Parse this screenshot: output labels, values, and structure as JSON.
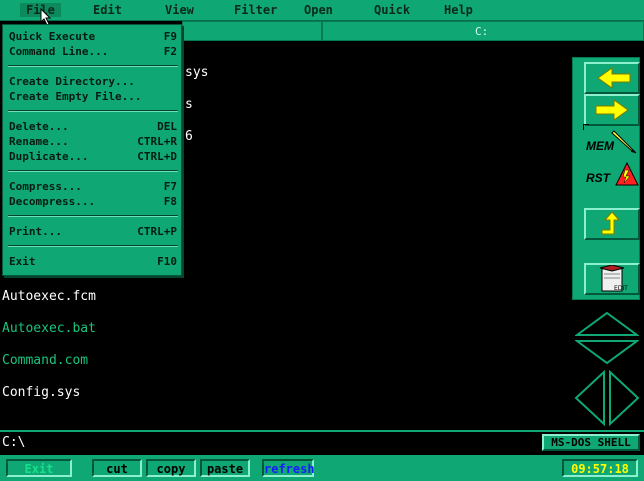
{
  "menubar": {
    "items": [
      {
        "label": "File",
        "active": true
      },
      {
        "label": "Edit"
      },
      {
        "label": "View"
      },
      {
        "label": "Filter"
      },
      {
        "label": "Open"
      },
      {
        "label": "Quick"
      },
      {
        "label": "Help"
      }
    ]
  },
  "panel": {
    "drive_label": "C:"
  },
  "file_menu": {
    "items": [
      {
        "label": "Quick Execute",
        "key": "F9"
      },
      {
        "label": "Command Line...",
        "key": "F2"
      },
      {
        "label": "Create Directory...",
        "key": ""
      },
      {
        "label": "Create Empty File...",
        "key": ""
      },
      {
        "label": "Delete...",
        "key": "DEL"
      },
      {
        "label": "Rename...",
        "key": "CTRL+R"
      },
      {
        "label": "Duplicate...",
        "key": "CTRL+D"
      },
      {
        "label": "Compress...",
        "key": "F7"
      },
      {
        "label": "Decompress...",
        "key": "F8"
      },
      {
        "label": "Print...",
        "key": "CTRL+P"
      },
      {
        "label": "Exit",
        "key": "F10"
      }
    ]
  },
  "files": {
    "hidden_partial": [
      "sys",
      "s",
      "6"
    ],
    "visible": [
      {
        "name": "Autoexec.fcm",
        "color": "white"
      },
      {
        "name": "Autoexec.bat",
        "color": "green"
      },
      {
        "name": "Command.com",
        "color": "green"
      },
      {
        "name": "Config.sys",
        "color": "white"
      }
    ]
  },
  "side_panel": {
    "mem_label": "MEM",
    "rst_label": "RST",
    "edit_label": "EDIT"
  },
  "command_line": {
    "prompt": "C:\\"
  },
  "shell_badge": "MS-DOS SHELL",
  "bottom": {
    "exit_label": "Exit",
    "cut_label": "cut",
    "copy_label": "copy",
    "paste_label": "paste",
    "refresh_label": "refresh",
    "clock": "09:57:18"
  },
  "colors": {
    "accent": "#0fa874",
    "accent_dark": "#03583a",
    "highlight": "#8cf0cf",
    "yellow": "#ffff00",
    "refresh_blue": "#1a1aff"
  }
}
